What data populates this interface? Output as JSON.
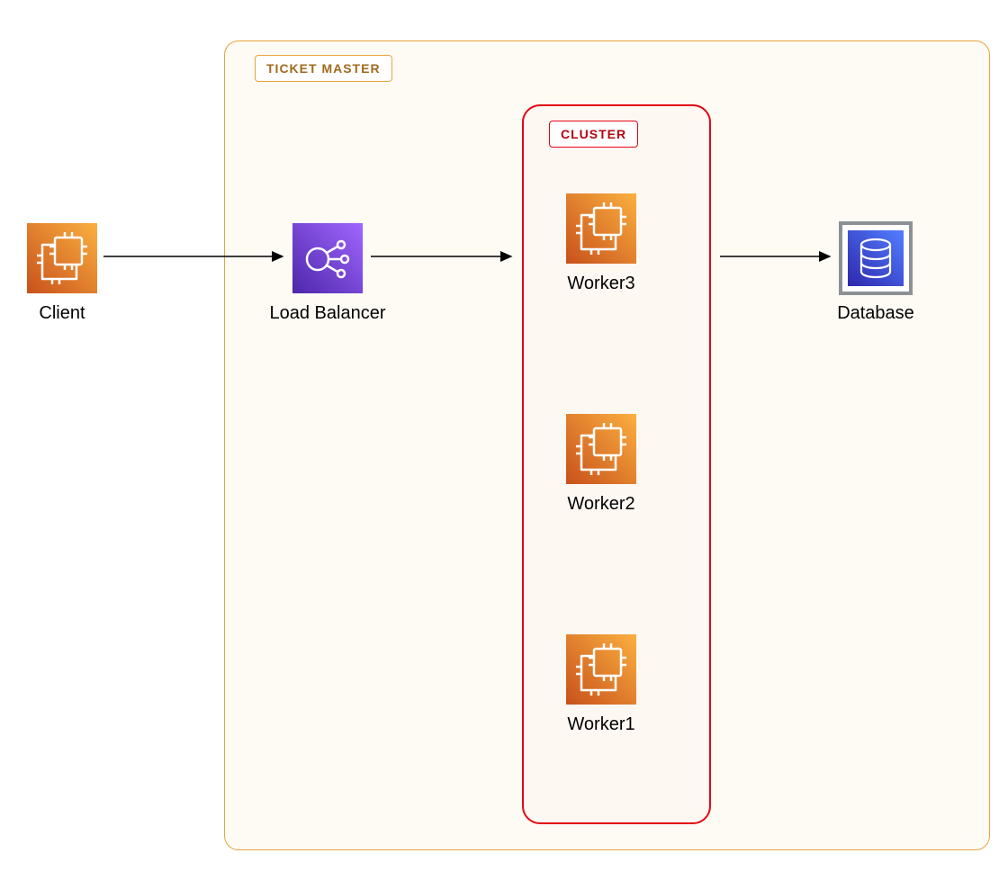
{
  "labels": {
    "client": "Client",
    "load_balancer": "Load Balancer",
    "worker3": "Worker3",
    "worker2": "Worker2",
    "worker1": "Worker1",
    "database": "Database"
  },
  "containers": {
    "ticket_master": "TICKET MASTER",
    "cluster": "CLUSTER"
  },
  "colors": {
    "orange_start": "#d05b1a",
    "orange_end": "#f6a724",
    "purple_start": "#4d27aa",
    "purple_end": "#9a5ee3",
    "blue_start": "#2e27ad",
    "blue_end": "#527fff",
    "tm_border": "#e8a33d",
    "cluster_border": "#e30613"
  }
}
